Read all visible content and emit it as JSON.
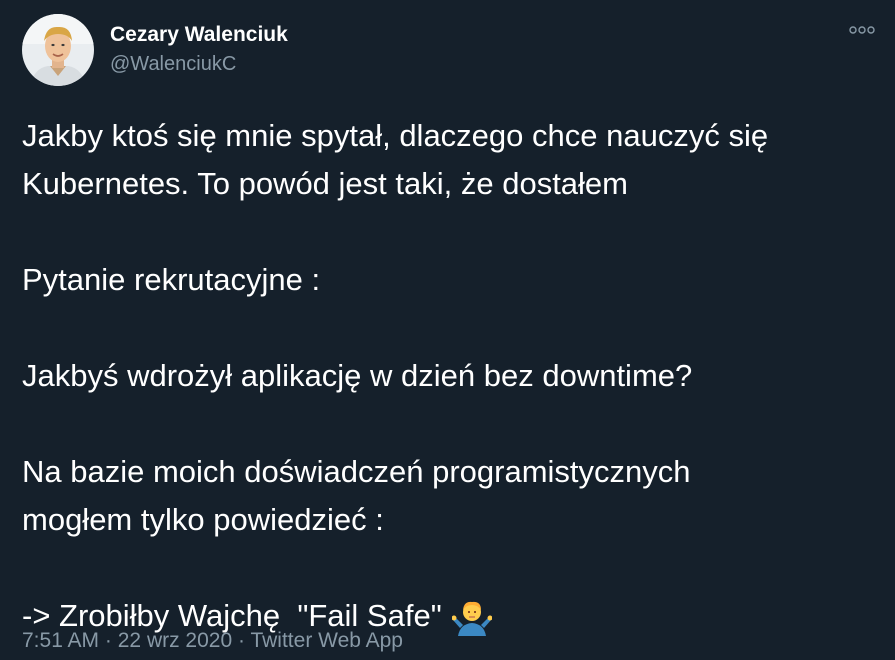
{
  "tweet": {
    "author": {
      "display_name": "Cezary Walenciuk",
      "handle": "@WalenciukC"
    },
    "text_lines": [
      "Jakby ktoś się mnie spytał, dlaczego chce nauczyć się",
      "Kubernetes. To powód jest taki, że dostałem",
      "",
      "Pytanie rekrutacyjne :",
      "",
      "Jakbyś wdrożył aplikację w dzień bez downtime?",
      "",
      "Na bazie moich doświadczeń programistycznych",
      "mogłem tylko powiedzieć :",
      "",
      "-> Zrobiłby Wajchę  \"Fail Safe\""
    ],
    "emoji": "person-shrugging-icon",
    "time": "7:51 AM",
    "separator": "·",
    "date": "22 wrz 2020",
    "source": "Twitter Web App"
  },
  "colors": {
    "background": "#15202b",
    "text": "#ffffff",
    "secondary": "#8899a6"
  }
}
